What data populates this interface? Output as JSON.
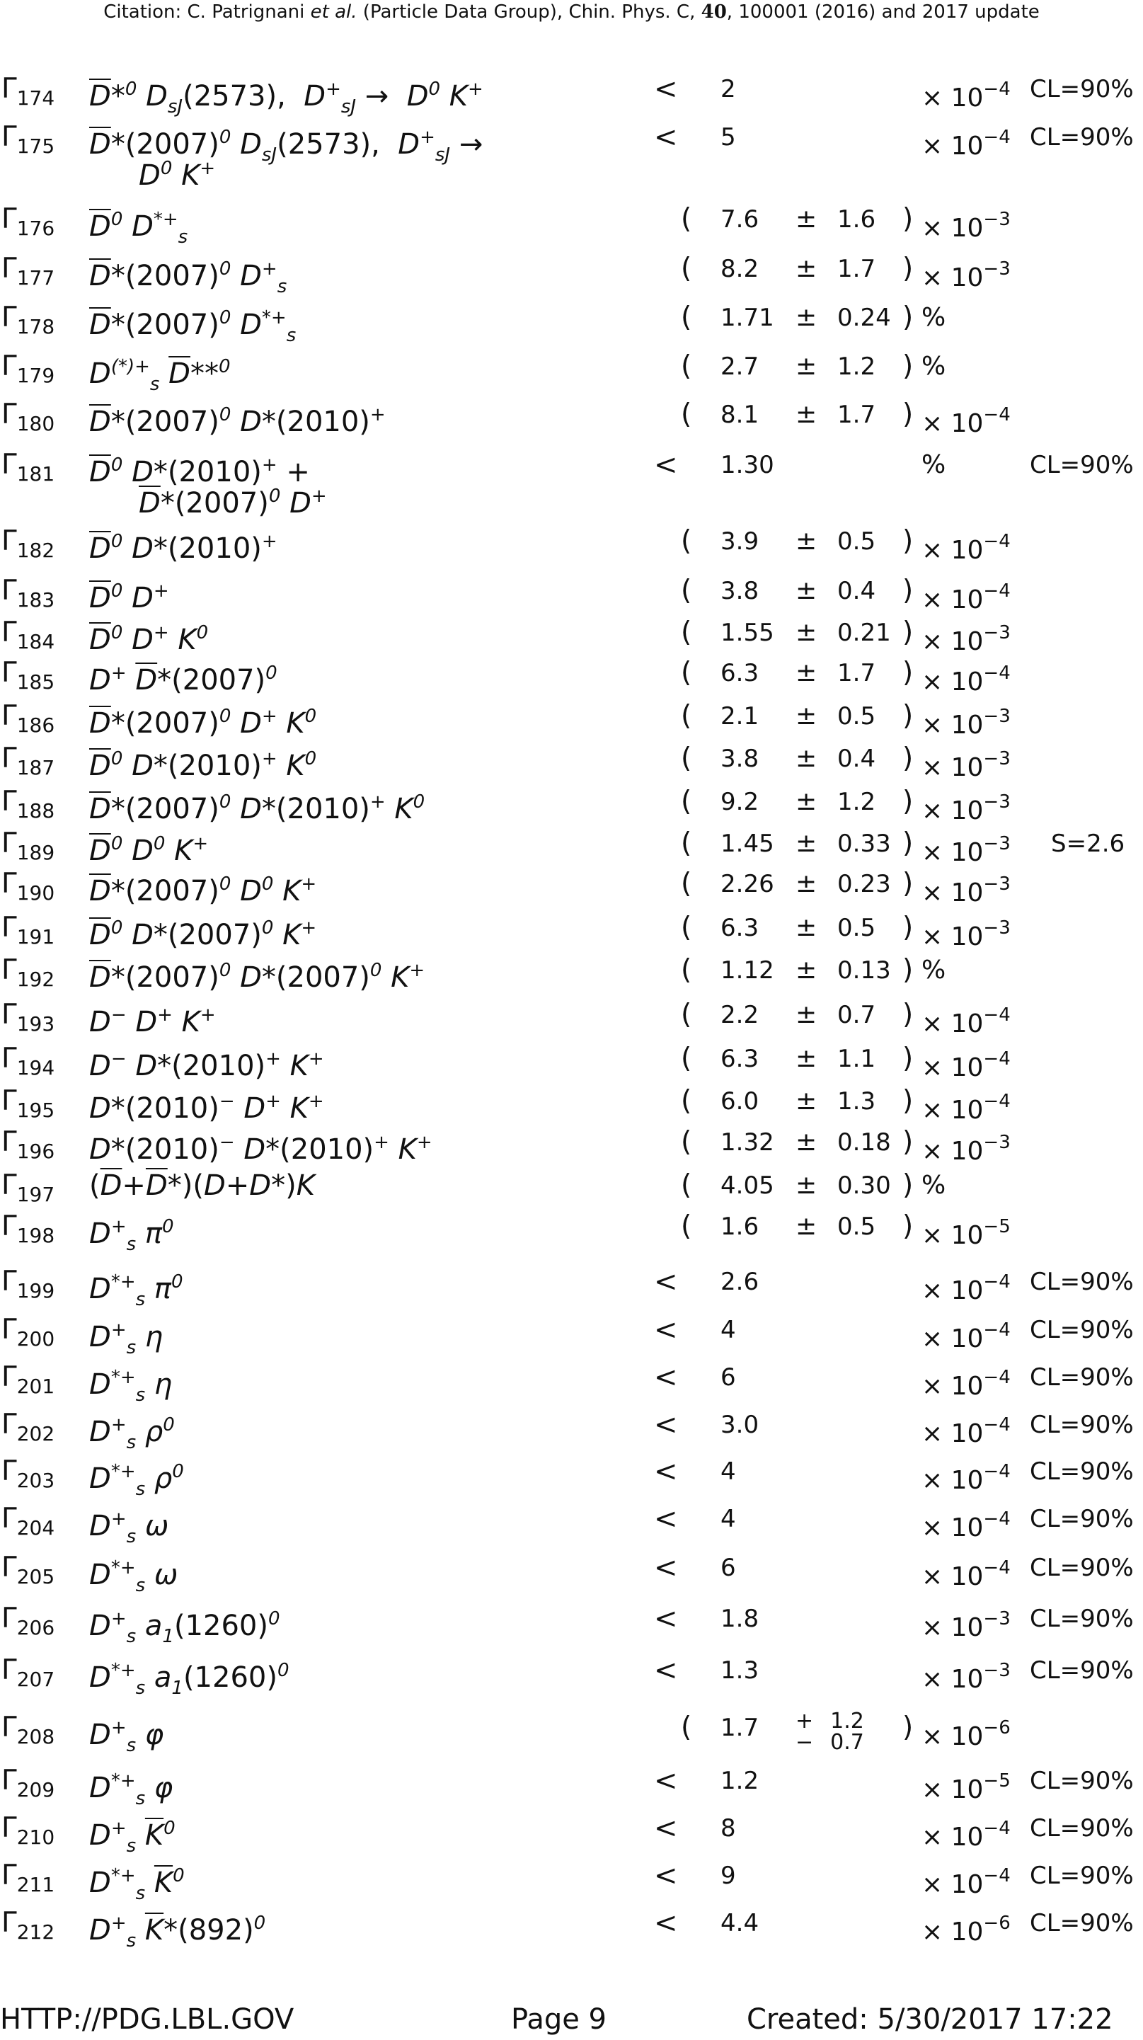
{
  "header": {
    "citation_prefix": "Citation: C. Patrignani ",
    "citation_etal": "et al.",
    "citation_mid": " (Particle Data Group), Chin. Phys. C, ",
    "citation_volume": "40",
    "citation_suffix": ", 100001 (2016) and 2017 update"
  },
  "rows": [
    {
      "id": "174",
      "mode": "<span class=\"ovl\">D</span>*<sup>0</sup> D<sub>sJ</sub><span class=\"up\">(2573),</span>&nbsp; D<sup>+</sup><sub>sJ</sub> <span class=\"up\">&rarr;</span>&nbsp; D<sup>0</sup> K<sup>+</sup>",
      "limit": "<",
      "value": "2",
      "unit": "× 10",
      "exp": "−4",
      "cl": "CL=90%"
    },
    {
      "id": "175",
      "mode": "<span class=\"ovl\">D</span>*<span class=\"up\">(2007)</span><sup>0</sup> D<sub>sJ</sub><span class=\"up\">(2573),</span>&nbsp; D<sup>+</sup><sub>sJ</sub> <span class=\"up\">&rarr;</span><span class=\"cont\">D<sup>0</sup> K<sup>+</sup></span>",
      "limit": "<",
      "value": "5",
      "unit": "× 10",
      "exp": "−4",
      "cl": "CL=90%"
    },
    {
      "id": "176",
      "mode": "<span class=\"ovl\">D</span><sup>0</sup> D<sup>*+</sup><sub>s</sub>",
      "value": "7.6",
      "err": "1.6",
      "unit": "× 10",
      "exp": "−3"
    },
    {
      "id": "177",
      "mode": "<span class=\"ovl\">D</span>*<span class=\"up\">(2007)</span><sup>0</sup> D<sup>+</sup><sub>s</sub>",
      "value": "8.2",
      "err": "1.7",
      "unit": "× 10",
      "exp": "−3"
    },
    {
      "id": "178",
      "mode": "<span class=\"ovl\">D</span>*<span class=\"up\">(2007)</span><sup>0</sup> D<sup>*+</sup><sub>s</sub>",
      "value": "1.71",
      "err": "0.24",
      "unit": "%"
    },
    {
      "id": "179",
      "mode": "D<sup>(*)+</sup><sub>s</sub> <span class=\"ovl\">D</span>**<sup>0</sup>",
      "value": "2.7",
      "err": "1.2",
      "unit": "%"
    },
    {
      "id": "180",
      "mode": "<span class=\"ovl\">D</span>*<span class=\"up\">(2007)</span><sup>0</sup> D*<span class=\"up\">(2010)</span><sup>+</sup>",
      "value": "8.1",
      "err": "1.7",
      "unit": "× 10",
      "exp": "−4"
    },
    {
      "id": "181",
      "mode": "<span class=\"ovl\">D</span><sup>0</sup> D*<span class=\"up\">(2010)</span><sup>+</sup> <span class=\"up\">+</span><span class=\"cont\"><span class=\"ovl\">D</span>*<span class=\"up\">(2007)</span><sup>0</sup> D<sup>+</sup></span>",
      "limit": "<",
      "value": "1.30",
      "unit": "%",
      "cl": "CL=90%"
    },
    {
      "id": "182",
      "mode": "<span class=\"ovl\">D</span><sup>0</sup> D*<span class=\"up\">(2010)</span><sup>+</sup>",
      "value": "3.9",
      "err": "0.5",
      "unit": "× 10",
      "exp": "−4"
    },
    {
      "id": "183",
      "mode": "<span class=\"ovl\">D</span><sup>0</sup> D<sup>+</sup>",
      "value": "3.8",
      "err": "0.4",
      "unit": "× 10",
      "exp": "−4"
    },
    {
      "id": "184",
      "mode": "<span class=\"ovl\">D</span><sup>0</sup> D<sup>+</sup> K<sup>0</sup>",
      "value": "1.55",
      "err": "0.21",
      "unit": "× 10",
      "exp": "−3"
    },
    {
      "id": "185",
      "mode": "D<sup>+</sup> <span class=\"ovl\">D</span>*<span class=\"up\">(2007)</span><sup>0</sup>",
      "value": "6.3",
      "err": "1.7",
      "unit": "× 10",
      "exp": "−4"
    },
    {
      "id": "186",
      "mode": "<span class=\"ovl\">D</span>*<span class=\"up\">(2007)</span><sup>0</sup> D<sup>+</sup> K<sup>0</sup>",
      "value": "2.1",
      "err": "0.5",
      "unit": "× 10",
      "exp": "−3"
    },
    {
      "id": "187",
      "mode": "<span class=\"ovl\">D</span><sup>0</sup> D*<span class=\"up\">(2010)</span><sup>+</sup> K<sup>0</sup>",
      "value": "3.8",
      "err": "0.4",
      "unit": "× 10",
      "exp": "−3"
    },
    {
      "id": "188",
      "mode": "<span class=\"ovl\">D</span>*<span class=\"up\">(2007)</span><sup>0</sup> D*<span class=\"up\">(2010)</span><sup>+</sup> K<sup>0</sup>",
      "value": "9.2",
      "err": "1.2",
      "unit": "× 10",
      "exp": "−3"
    },
    {
      "id": "189",
      "mode": "<span class=\"ovl\">D</span><sup>0</sup> D<sup>0</sup> K<sup>+</sup>",
      "value": "1.45",
      "err": "0.33",
      "unit": "× 10",
      "exp": "−3",
      "scale": "S=2.6"
    },
    {
      "id": "190",
      "mode": "<span class=\"ovl\">D</span>*<span class=\"up\">(2007)</span><sup>0</sup> D<sup>0</sup> K<sup>+</sup>",
      "value": "2.26",
      "err": "0.23",
      "unit": "× 10",
      "exp": "−3"
    },
    {
      "id": "191",
      "mode": "<span class=\"ovl\">D</span><sup>0</sup> D*<span class=\"up\">(2007)</span><sup>0</sup> K<sup>+</sup>",
      "value": "6.3",
      "err": "0.5",
      "unit": "× 10",
      "exp": "−3"
    },
    {
      "id": "192",
      "mode": "<span class=\"ovl\">D</span>*<span class=\"up\">(2007)</span><sup>0</sup> D*<span class=\"up\">(2007)</span><sup>0</sup> K<sup>+</sup>",
      "value": "1.12",
      "err": "0.13",
      "unit": "%"
    },
    {
      "id": "193",
      "mode": "D<sup>−</sup> D<sup>+</sup> K<sup>+</sup>",
      "value": "2.2",
      "err": "0.7",
      "unit": "× 10",
      "exp": "−4"
    },
    {
      "id": "194",
      "mode": "D<sup>−</sup> D*<span class=\"up\">(2010)</span><sup>+</sup> K<sup>+</sup>",
      "value": "6.3",
      "err": "1.1",
      "unit": "× 10",
      "exp": "−4"
    },
    {
      "id": "195",
      "mode": "D*<span class=\"up\">(2010)</span><sup>−</sup> D<sup>+</sup> K<sup>+</sup>",
      "value": "6.0",
      "err": "1.3",
      "unit": "× 10",
      "exp": "−4"
    },
    {
      "id": "196",
      "mode": "D*<span class=\"up\">(2010)</span><sup>−</sup> D*<span class=\"up\">(2010)</span><sup>+</sup> K<sup>+</sup>",
      "value": "1.32",
      "err": "0.18",
      "unit": "× 10",
      "exp": "−3"
    },
    {
      "id": "197",
      "mode": "<span class=\"up\">(</span><span class=\"ovl\">D</span><span class=\"up\">+</span><span class=\"ovl\">D</span>*<span class=\"up\">)(</span>D<span class=\"up\">+</span>D*<span class=\"up\">)</span>K",
      "value": "4.05",
      "err": "0.30",
      "unit": "%"
    },
    {
      "id": "198",
      "mode": "D<sup>+</sup><sub>s</sub> π<sup>0</sup>",
      "value": "1.6",
      "err": "0.5",
      "unit": "× 10",
      "exp": "−5"
    },
    {
      "id": "199",
      "mode": "D<sup>*+</sup><sub>s</sub> π<sup>0</sup>",
      "limit": "<",
      "value": "2.6",
      "unit": "× 10",
      "exp": "−4",
      "cl": "CL=90%"
    },
    {
      "id": "200",
      "mode": "D<sup>+</sup><sub>s</sub> η",
      "limit": "<",
      "value": "4",
      "unit": "× 10",
      "exp": "−4",
      "cl": "CL=90%"
    },
    {
      "id": "201",
      "mode": "D<sup>*+</sup><sub>s</sub> η",
      "limit": "<",
      "value": "6",
      "unit": "× 10",
      "exp": "−4",
      "cl": "CL=90%"
    },
    {
      "id": "202",
      "mode": "D<sup>+</sup><sub>s</sub> ρ<sup>0</sup>",
      "limit": "<",
      "value": "3.0",
      "unit": "× 10",
      "exp": "−4",
      "cl": "CL=90%"
    },
    {
      "id": "203",
      "mode": "D<sup>*+</sup><sub>s</sub> ρ<sup>0</sup>",
      "limit": "<",
      "value": "4",
      "unit": "× 10",
      "exp": "−4",
      "cl": "CL=90%"
    },
    {
      "id": "204",
      "mode": "D<sup>+</sup><sub>s</sub> ω",
      "limit": "<",
      "value": "4",
      "unit": "× 10",
      "exp": "−4",
      "cl": "CL=90%"
    },
    {
      "id": "205",
      "mode": "D<sup>*+</sup><sub>s</sub> ω",
      "limit": "<",
      "value": "6",
      "unit": "× 10",
      "exp": "−4",
      "cl": "CL=90%"
    },
    {
      "id": "206",
      "mode": "D<sup>+</sup><sub>s</sub> a<sub>1</sub><span class=\"up\">(1260)</span><sup>0</sup>",
      "limit": "<",
      "value": "1.8",
      "unit": "× 10",
      "exp": "−3",
      "cl": "CL=90%"
    },
    {
      "id": "207",
      "mode": "D<sup>*+</sup><sub>s</sub> a<sub>1</sub><span class=\"up\">(1260)</span><sup>0</sup>",
      "limit": "<",
      "value": "1.3",
      "unit": "× 10",
      "exp": "−3",
      "cl": "CL=90%"
    },
    {
      "id": "208",
      "mode": "D<sup>+</sup><sub>s</sub> φ",
      "value": "1.7",
      "err_plus": "1.2",
      "err_minus": "0.7",
      "unit": "× 10",
      "exp": "−6"
    },
    {
      "id": "209",
      "mode": "D<sup>*+</sup><sub>s</sub> φ",
      "limit": "<",
      "value": "1.2",
      "unit": "× 10",
      "exp": "−5",
      "cl": "CL=90%"
    },
    {
      "id": "210",
      "mode": "D<sup>+</sup><sub>s</sub> <span class=\"ovl\">K</span><sup>0</sup>",
      "limit": "<",
      "value": "8",
      "unit": "× 10",
      "exp": "−4",
      "cl": "CL=90%"
    },
    {
      "id": "211",
      "mode": "D<sup>*+</sup><sub>s</sub> <span class=\"ovl\">K</span><sup>0</sup>",
      "limit": "<",
      "value": "9",
      "unit": "× 10",
      "exp": "−4",
      "cl": "CL=90%"
    },
    {
      "id": "212",
      "mode": "D<sup>+</sup><sub>s</sub> <span class=\"ovl\">K</span>*<span class=\"up\">(892)</span><sup>0</sup>",
      "limit": "<",
      "value": "4.4",
      "unit": "× 10",
      "exp": "−6",
      "cl": "CL=90%"
    }
  ],
  "footer": {
    "url": "HTTP://PDG.LBL.GOV",
    "page": "Page 9",
    "created": "Created: 5/30/2017 17:22"
  }
}
